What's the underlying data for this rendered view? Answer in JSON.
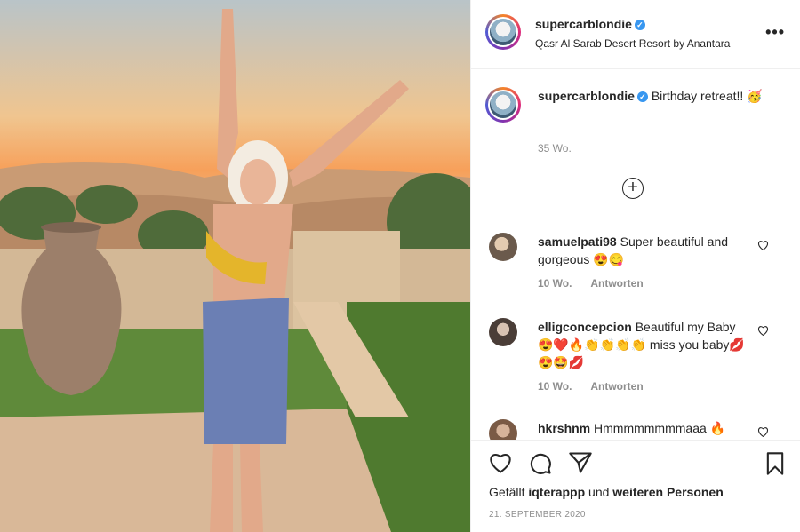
{
  "post": {
    "username": "supercarblondie",
    "location": "Qasr Al Sarab Desert Resort by Anantara",
    "more_label": "•••"
  },
  "caption": {
    "username": "supercarblondie",
    "text": "Birthday retreat!! 🥳",
    "time": "35 Wo."
  },
  "load_more_label": "+",
  "comments": [
    {
      "username": "samuelpati98",
      "text": "Super beautiful and gorgeous 😍😋",
      "time": "10 Wo.",
      "reply_label": "Antworten"
    },
    {
      "username": "elligconcepcion",
      "text": "Beautiful my Baby😍❤️🔥👏👏👏👏 miss you baby💋😍🤩💋",
      "time": "10 Wo.",
      "reply_label": "Antworten"
    },
    {
      "username": "hkrshnm",
      "text": "Hmmmmmmmmaaa 🔥",
      "time": "",
      "reply_label": ""
    }
  ],
  "footer": {
    "likes_prefix": "Gefällt",
    "likes_user": "iqterappp",
    "likes_middle": "und",
    "likes_suffix": "weiteren Personen",
    "date": "21. SEPTEMBER 2020"
  },
  "colors": {
    "verified": "#3897f0",
    "meta_text": "#8e8e8e",
    "primary_text": "#262626"
  },
  "icons": [
    "verified-badge-icon",
    "more-options-icon",
    "plus-circle-icon",
    "heart-icon",
    "comment-icon",
    "share-icon",
    "bookmark-icon"
  ]
}
